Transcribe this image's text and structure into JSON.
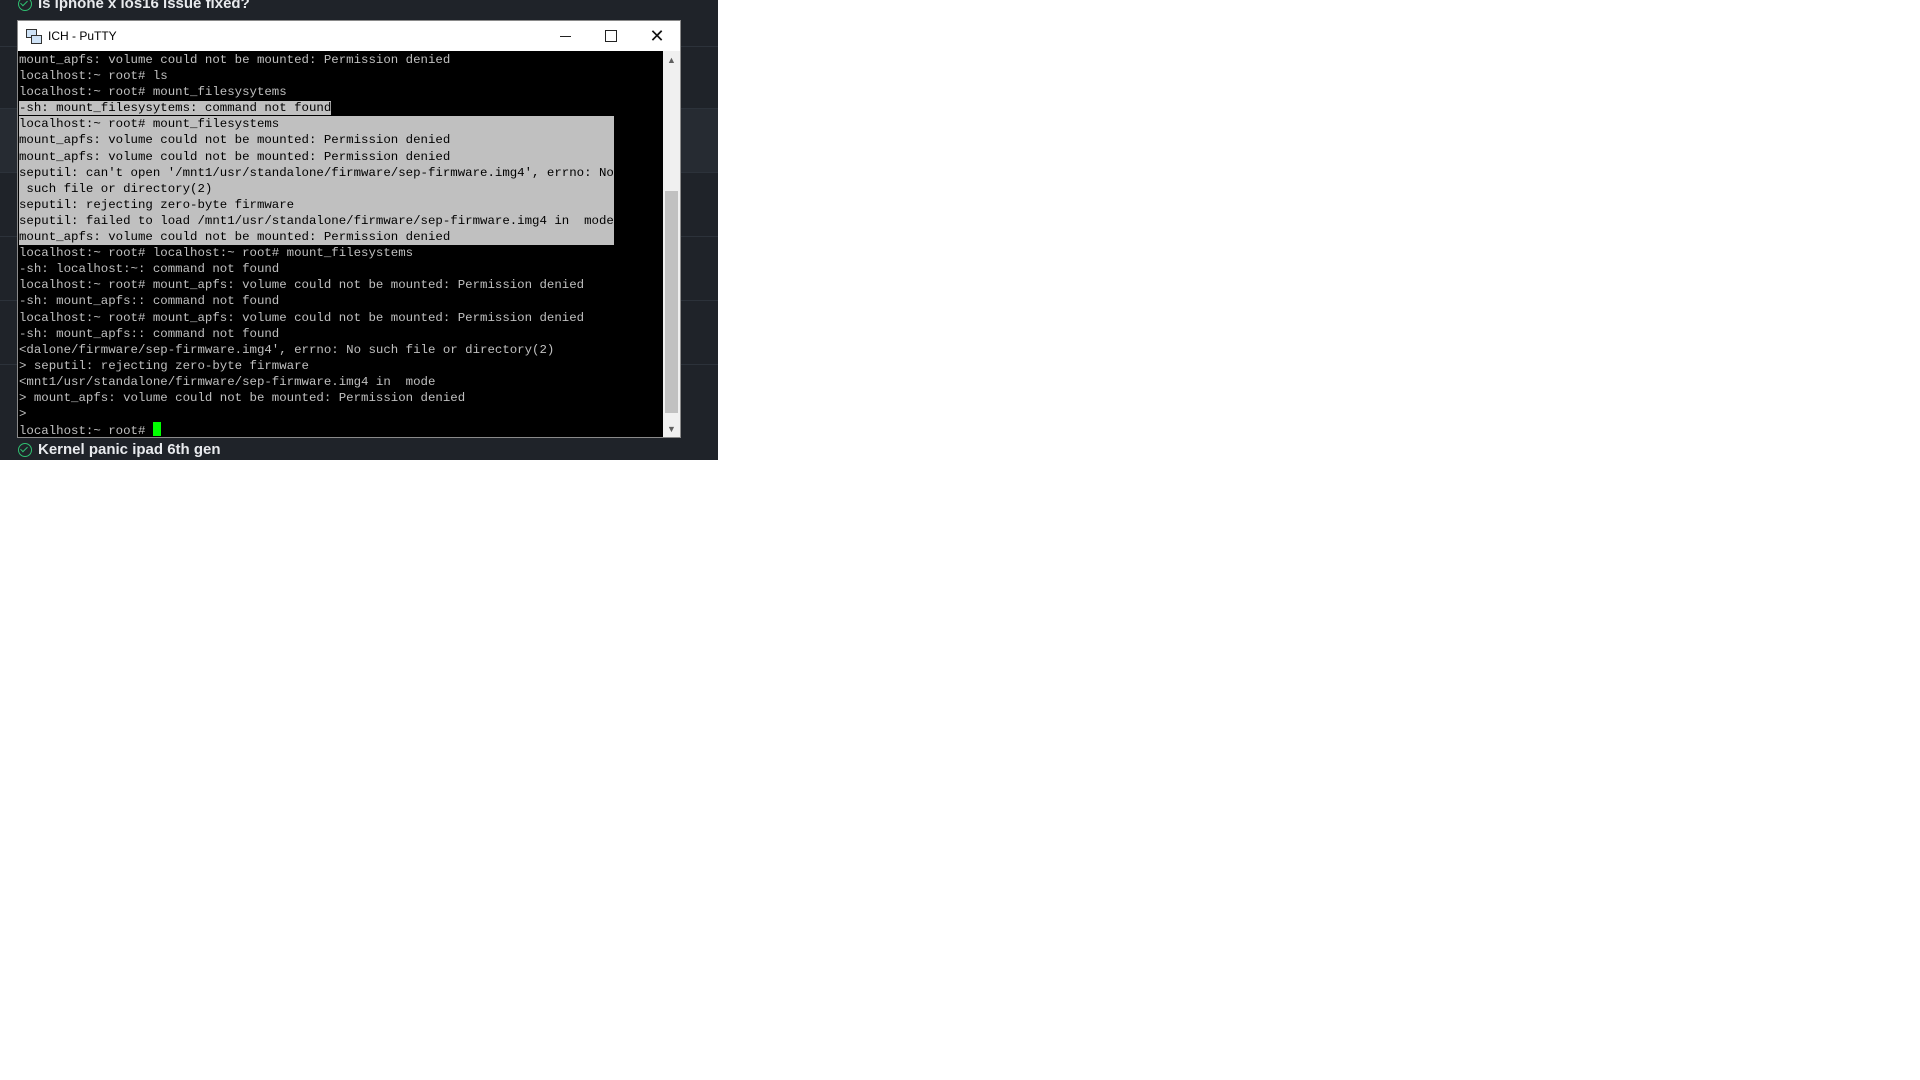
{
  "forum": {
    "threads": [
      {
        "title": "Is iphone x ios16 issue fixed?",
        "icon": "check-circle-icon"
      },
      {
        "title": "Kernel panic ipad 6th gen",
        "icon": "check-circle-icon"
      }
    ],
    "accent": "#2fbf71"
  },
  "window": {
    "title": "ICH - PuTTY",
    "icon": "putty-icon",
    "buttons": {
      "minimize": "minimize",
      "maximize": "maximize",
      "close": "close"
    }
  },
  "terminal": {
    "lines": [
      "mount_apfs: volume could not be mounted: Permission denied",
      "localhost:~ root# ls",
      "localhost:~ root# mount_filesysytems",
      "-sh: mount_filesysytems: command not found",
      "localhost:~ root# mount_filesystems",
      "mount_apfs: volume could not be mounted: Permission denied",
      "mount_apfs: volume could not be mounted: Permission denied",
      "seputil: can't open '/mnt1/usr/standalone/firmware/sep-firmware.img4', errno: No",
      " such file or directory(2)",
      "seputil: rejecting zero-byte firmware",
      "seputil: failed to load /mnt1/usr/standalone/firmware/sep-firmware.img4 in  mode",
      "mount_apfs: volume could not be mounted: Permission denied",
      "localhost:~ root# localhost:~ root# mount_filesystems",
      "-sh: localhost:~: command not found",
      "localhost:~ root# mount_apfs: volume could not be mounted: Permission denied",
      "-sh: mount_apfs:: command not found",
      "localhost:~ root# mount_apfs: volume could not be mounted: Permission denied",
      "-sh: mount_apfs:: command not found",
      "<dalone/firmware/sep-firmware.img4', errno: No such file or directory(2)",
      "> seputil: rejecting zero-byte firmware",
      "<mnt1/usr/standalone/firmware/sep-firmware.img4 in  mode",
      "> mount_apfs: volume could not be mounted: Permission denied",
      ">",
      "localhost:~ root# "
    ],
    "colors": {
      "foreground": "#c0c0c0",
      "background": "#000000",
      "selection": "#c0c0c0",
      "cursor": "#00ff00"
    }
  },
  "scrollbar": {
    "up_icon": "chevron-up-icon",
    "down_icon": "chevron-down-icon"
  }
}
